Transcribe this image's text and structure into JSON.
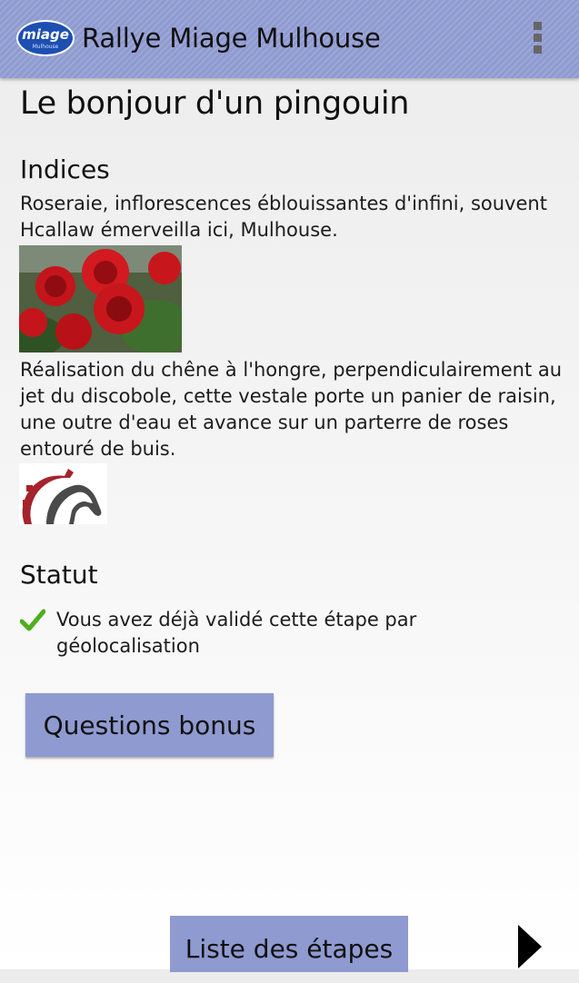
{
  "actionbar": {
    "logo_text": "miage",
    "logo_subtext": "Mulhouse",
    "title": "Rallye Miage Mulhouse",
    "overflow_icon": "overflow-menu-icon"
  },
  "step": {
    "title": "Le bonjour d'un pingouin",
    "hints_heading": "Indices",
    "hint_1": "Roseraie, inflorescences éblouissantes d'infini, souvent Hcallaw émerveilla ici, Mulhouse.",
    "hint_2": "Réalisation du chêne à l'hongre, perpendiculairement au jet du discobole, cette vestale porte un panier de raisin, une outre d'eau et avance sur un parterre de roses entouré de buis.",
    "status_heading": "Statut",
    "status_text": "Vous avez déjà validé cette étape par géolocalisation"
  },
  "buttons": {
    "bonus": "Questions bonus",
    "list": "Liste des étapes"
  },
  "colors": {
    "actionbar": "#8f9ad0",
    "button": "#8f9ad0",
    "check": "#4caf1f",
    "logo_red": "#a5232b"
  }
}
